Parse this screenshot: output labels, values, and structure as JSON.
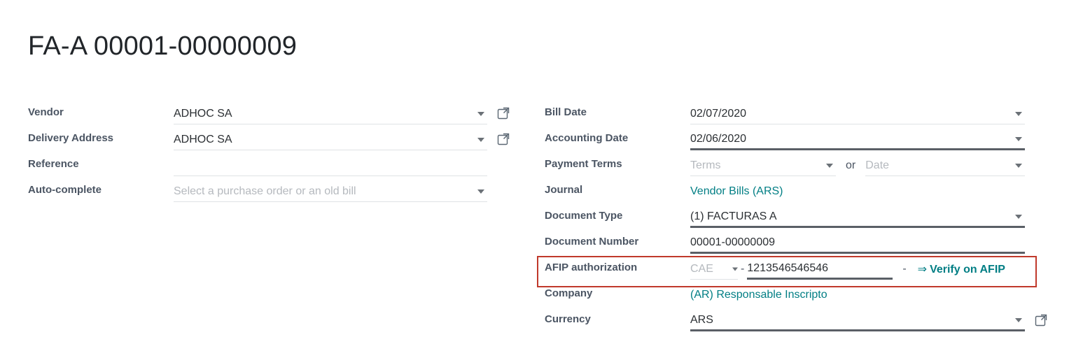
{
  "title": "FA-A 00001-00000009",
  "colors": {
    "link": "#017e84",
    "highlight": "#c0392b",
    "label": "#4b5563",
    "value": "#2b2f33"
  },
  "left_column": [
    {
      "label": "Vendor",
      "value": "ADHOC SA",
      "placeholder": "",
      "caret": true,
      "external_link": true,
      "underline": "light"
    },
    {
      "label": "Delivery Address",
      "value": "ADHOC SA",
      "placeholder": "",
      "caret": true,
      "external_link": true,
      "underline": "light"
    },
    {
      "label": "Reference",
      "value": "",
      "placeholder": "",
      "caret": false,
      "external_link": false,
      "underline": "light"
    },
    {
      "label": "Auto-complete",
      "value": "",
      "placeholder": "Select a purchase order or an old bill",
      "caret": true,
      "external_link": false,
      "underline": "light"
    }
  ],
  "right_column": {
    "bill_date": {
      "label": "Bill Date",
      "value": "02/07/2020"
    },
    "accounting_date": {
      "label": "Accounting Date",
      "value": "02/06/2020"
    },
    "payment_terms": {
      "label": "Payment Terms",
      "terms_placeholder": "Terms",
      "or_text": "or",
      "date_placeholder": "Date"
    },
    "journal": {
      "label": "Journal",
      "value": "Vendor Bills (ARS)"
    },
    "document_type": {
      "label": "Document Type",
      "value": "(1) FACTURAS A"
    },
    "document_number": {
      "label": "Document Number",
      "value": "00001-00000009"
    },
    "afip_authorization": {
      "label": "AFIP authorization",
      "type_value": "CAE",
      "separator": "-",
      "code": "1213546546546",
      "separator2": "-",
      "verify_arrow": "⇒",
      "verify_label": "Verify on AFIP"
    },
    "company": {
      "label": "Company",
      "value": "(AR) Responsable Inscripto"
    },
    "currency": {
      "label": "Currency",
      "value": "ARS"
    }
  }
}
